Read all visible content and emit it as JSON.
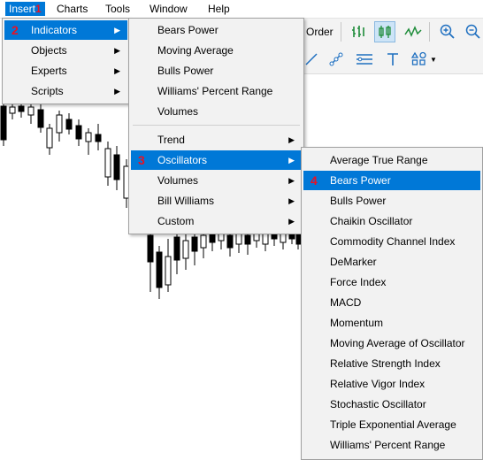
{
  "menubar": {
    "items": [
      "Insert",
      "Charts",
      "Tools",
      "Window",
      "Help"
    ],
    "step_markers": {
      "insert": "1"
    }
  },
  "toolbar": {
    "order_label": "Order"
  },
  "insert_menu": {
    "items": [
      {
        "label": "Indicators",
        "step": "2",
        "has_submenu": true
      },
      {
        "label": "Objects",
        "has_submenu": true
      },
      {
        "label": "Experts",
        "has_submenu": true
      },
      {
        "label": "Scripts",
        "has_submenu": true
      }
    ]
  },
  "indicators_menu": {
    "top_items": [
      "Bears Power",
      "Moving Average",
      "Bulls Power",
      "Williams' Percent Range",
      "Volumes"
    ],
    "group_items": [
      {
        "label": "Trend",
        "has_submenu": true
      },
      {
        "label": "Oscillators",
        "step": "3",
        "has_submenu": true
      },
      {
        "label": "Volumes",
        "has_submenu": true
      },
      {
        "label": "Bill Williams",
        "has_submenu": true
      },
      {
        "label": "Custom",
        "has_submenu": true
      }
    ]
  },
  "oscillators_menu": {
    "items": [
      {
        "label": "Average True Range"
      },
      {
        "label": "Bears Power",
        "step": "4"
      },
      {
        "label": "Bulls Power"
      },
      {
        "label": "Chaikin Oscillator"
      },
      {
        "label": "Commodity Channel Index"
      },
      {
        "label": "DeMarker"
      },
      {
        "label": "Force Index"
      },
      {
        "label": "MACD"
      },
      {
        "label": "Momentum"
      },
      {
        "label": "Moving Average of Oscillator"
      },
      {
        "label": "Relative Strength Index"
      },
      {
        "label": "Relative Vigor Index"
      },
      {
        "label": "Stochastic Oscillator"
      },
      {
        "label": "Triple Exponential Average"
      },
      {
        "label": "Williams' Percent Range"
      }
    ]
  },
  "icons": {
    "toolbar": [
      "bar-chart-icon",
      "candlestick-icon",
      "line-chart-icon",
      "zoom-in-icon",
      "zoom-out-icon",
      "trendline-icon",
      "channel-icon",
      "fibonacci-icon",
      "text-icon",
      "shapes-icon"
    ]
  },
  "colors": {
    "accent": "#0078d7",
    "step_marker": "#e81123",
    "toolbar_icon": "#1e8c3a"
  }
}
